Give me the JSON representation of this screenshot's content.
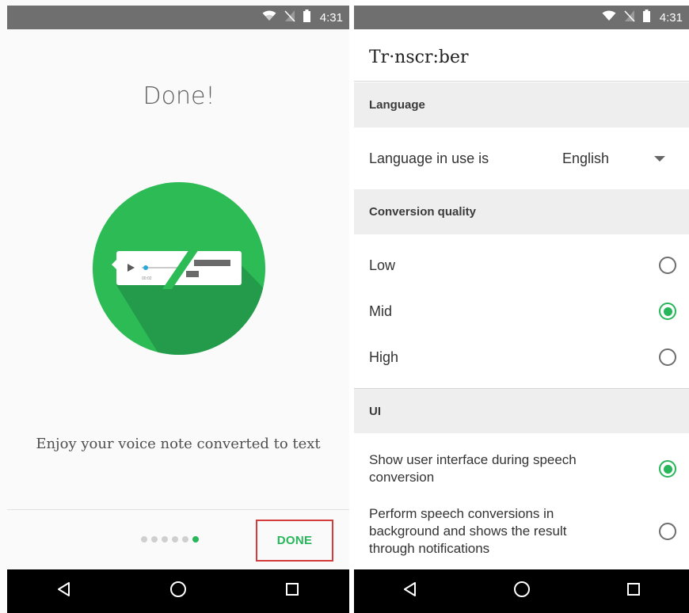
{
  "status_bar": {
    "time": "4:31"
  },
  "left": {
    "title": "Done!",
    "illustration": {
      "timestamp": "00:02"
    },
    "caption": "Enjoy your voice note converted to text",
    "pager": {
      "total": 6,
      "active_index": 5
    },
    "done_button_label": "DONE"
  },
  "right": {
    "app_title": "Tr·nscr:ber",
    "sections": {
      "language": {
        "header": "Language",
        "label": "Language in use is",
        "value": "English"
      },
      "quality": {
        "header": "Conversion quality",
        "options": [
          {
            "label": "Low",
            "checked": false
          },
          {
            "label": "Mid",
            "checked": true
          },
          {
            "label": "High",
            "checked": false
          }
        ]
      },
      "ui": {
        "header": "UI",
        "options": [
          {
            "label": "Show user interface during speech conversion",
            "checked": true
          },
          {
            "label": "Perform speech conversions in background and shows the result through notifications",
            "checked": false
          }
        ]
      }
    }
  },
  "colors": {
    "accent": "#28b65a",
    "highlight_border": "#d43c3c",
    "status_bar": "#6f6f6f"
  },
  "icons": [
    "wifi-icon",
    "no-sim-icon",
    "battery-icon",
    "back-icon",
    "home-icon",
    "recents-icon",
    "play-icon"
  ]
}
